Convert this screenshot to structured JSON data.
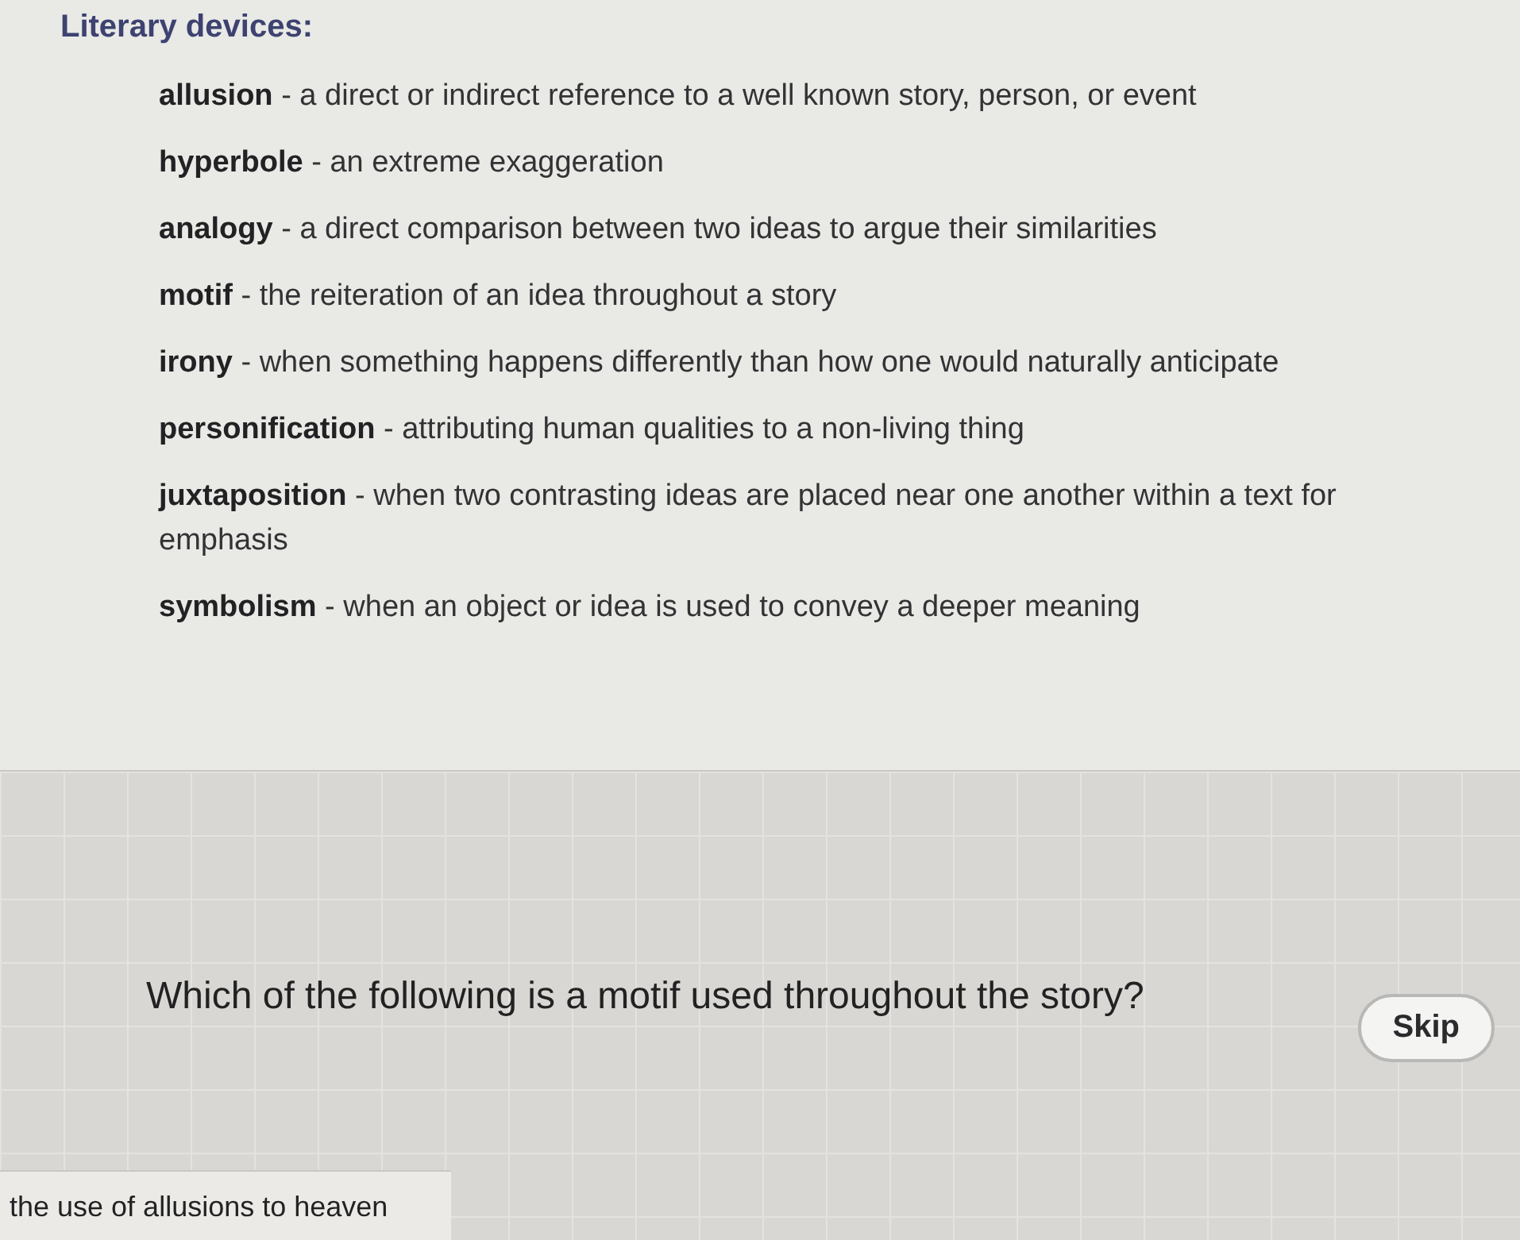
{
  "devices_panel": {
    "heading": "Literary devices:",
    "devices": [
      "**allusion** - a direct or indirect reference to a well known story, person, or event",
      "**hyperbole** - an extreme exaggeration",
      "**analogy** - a direct comparison between two ideas to argue their similarities",
      "**motif** - the reiteration of an idea throughout a story",
      "**irony** - when something happens differently than how one would naturally anticipate",
      "**personification** - attributing human qualities to a non-living thing",
      "**juxtaposition** - when two contrasting ideas are placed near one another within a text for emphasis",
      "**symbolism** - when an object or idea is used to convey a deeper meaning"
    ]
  },
  "question": {
    "text": "Which of the following is a motif used throughout the story?",
    "skip_button": "Skip"
  },
  "answers": [
    {
      "text": "the use of allusions to heaven"
    }
  ]
}
